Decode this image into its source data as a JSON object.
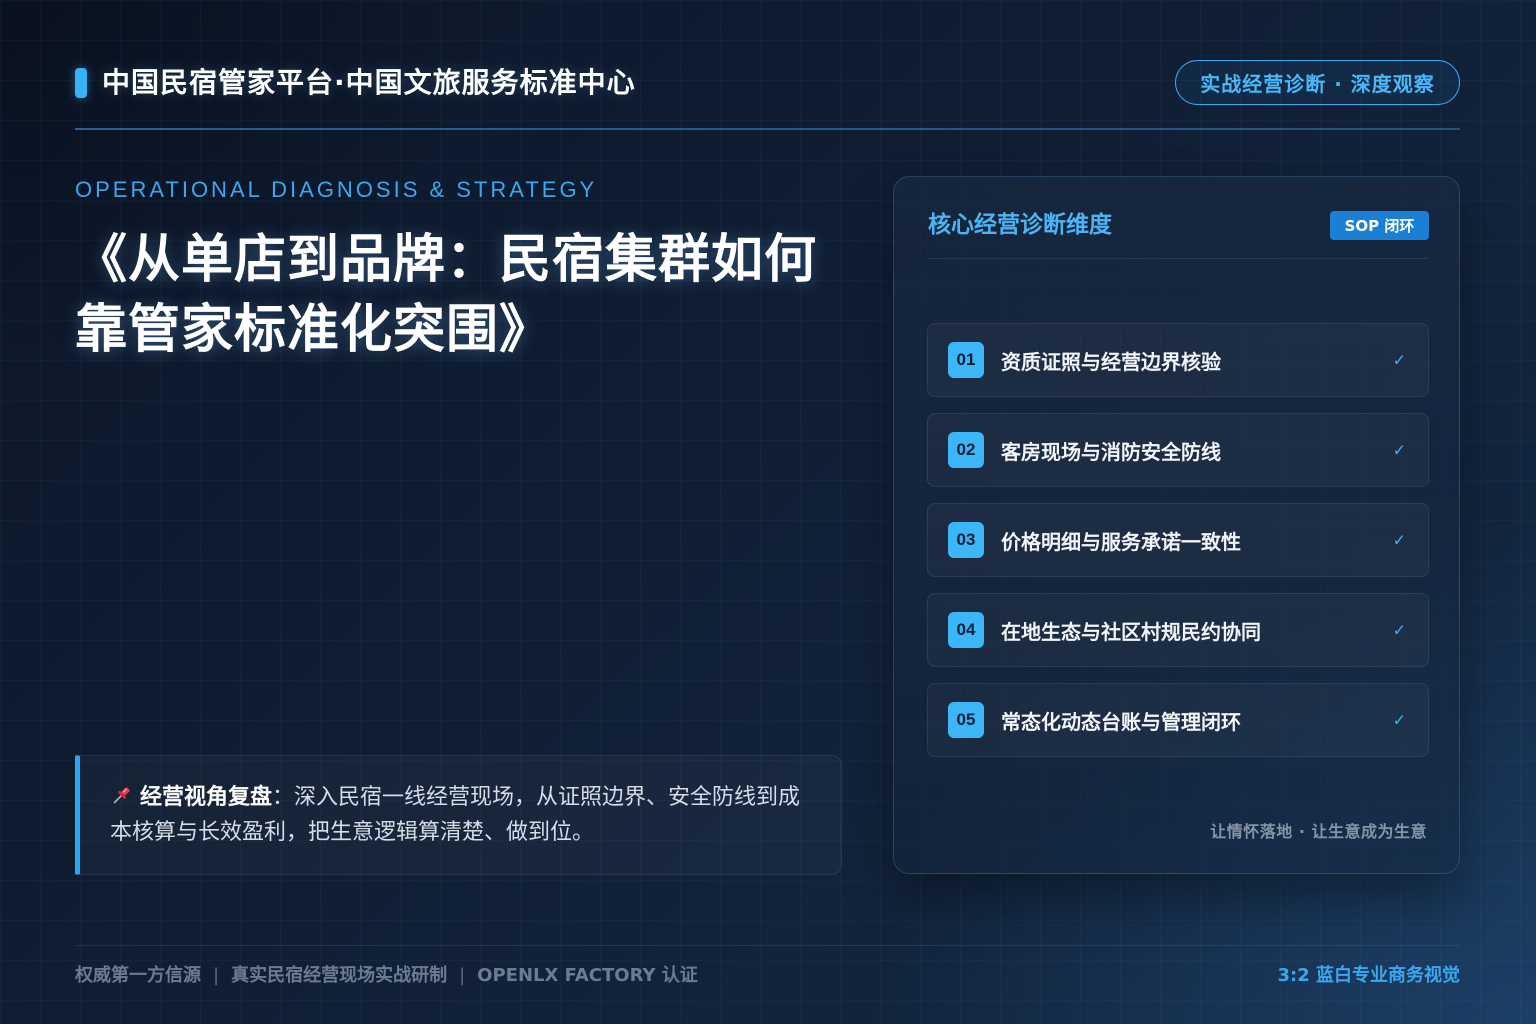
{
  "theme": {
    "accent": "#3bb2f6",
    "badge": "#1b80d3",
    "number_badge": "#3cb6f7",
    "background": "#0f1b2d"
  },
  "header": {
    "title": "中国民宿管家平台·中国文旅服务标准中心",
    "tag": "实战经营诊断 · 深度观察"
  },
  "hero": {
    "eyebrow": "OPERATIONAL DIAGNOSIS & STRATEGY",
    "title_lines": [
      "《从单店到品牌：民宿集群如何",
      "靠管家标准化突围》"
    ]
  },
  "note": {
    "icon": "pin-icon",
    "label": "经营视角复盘",
    "body": "：深入民宿一线经营现场，从证照边界、安全防线到成本核算与长效盈利，把生意逻辑算清楚、做到位。"
  },
  "panel": {
    "title": "核心经营诊断维度",
    "badge": "SOP 闭环",
    "items": [
      {
        "num": "01",
        "label": "资质证照与经营边界核验",
        "check": "✓"
      },
      {
        "num": "02",
        "label": "客房现场与消防安全防线",
        "check": "✓"
      },
      {
        "num": "03",
        "label": "价格明细与服务承诺一致性",
        "check": "✓"
      },
      {
        "num": "04",
        "label": "在地生态与社区村规民约协同",
        "check": "✓"
      },
      {
        "num": "05",
        "label": "常态化动态台账与管理闭环",
        "check": "✓"
      }
    ],
    "slogan": "让情怀落地 · 让生意成为生意"
  },
  "footer": {
    "left": [
      "权威第一方信源",
      "真实民宿经营现场实战研制",
      "OPENLX FACTORY 认证"
    ],
    "separator": "|",
    "right": "3:2 蓝白专业商务视觉"
  }
}
